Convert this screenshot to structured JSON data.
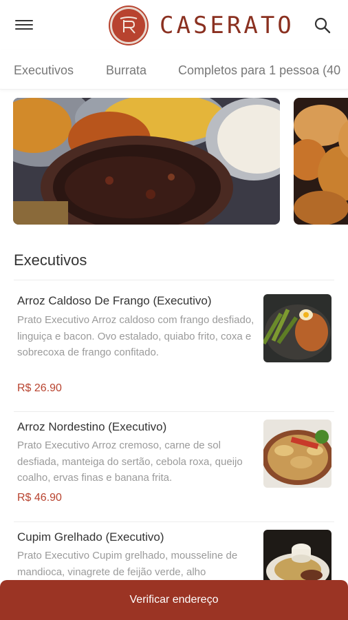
{
  "header": {
    "brand": "CASERATO",
    "brand_mark": "R"
  },
  "tabs": [
    {
      "label": "Executivos"
    },
    {
      "label": "Burrata"
    },
    {
      "label": "Completos para 1 pessoa (40"
    }
  ],
  "section": {
    "title": "Executivos"
  },
  "items": [
    {
      "name": "Arroz Caldoso De Frango (Executivo)",
      "desc": "Prato Executivo Arroz caldoso com frango desfiado, linguiça e bacon. Ovo estalado, quiabo frito, coxa e sobrecoxa de frango confitado.",
      "price": "R$ 26.90"
    },
    {
      "name": "Arroz Nordestino (Executivo)",
      "desc": "Prato Executivo Arroz cremoso, carne de sol desfiada, manteiga do sertão, cebola roxa, queijo coalho, ervas finas e banana frita.",
      "price": "R$ 46.90"
    },
    {
      "name": "Cupim Grelhado (Executivo)",
      "desc": "Prato Executivo Cupim grelhado, mousseline de mandioca, vinagrete de feijão verde, alho",
      "price": ""
    }
  ],
  "footer": {
    "cta": "Verificar endereço"
  },
  "colors": {
    "brand": "#9b3424",
    "price": "#b8432f"
  }
}
